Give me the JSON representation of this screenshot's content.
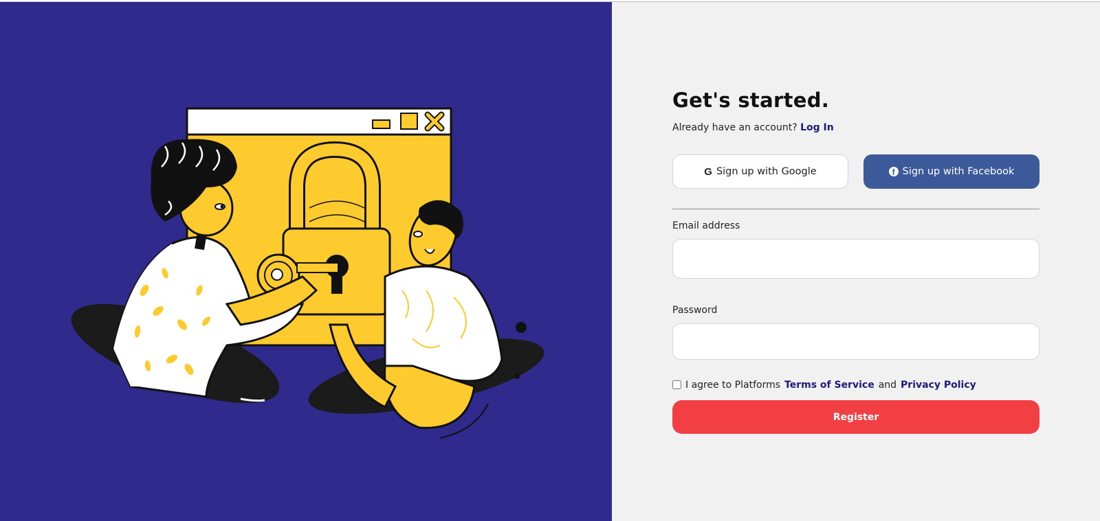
{
  "heading": "Get's started.",
  "login_prompt": {
    "text": "Already have an account?",
    "link_label": "Log In"
  },
  "social": {
    "google_label": "Sign up with Google",
    "facebook_label": "Sign up with Facebook"
  },
  "form": {
    "email_label": "Email address",
    "email_value": "",
    "password_label": "Password",
    "password_value": "",
    "agree_prefix": "I agree to Platforms",
    "terms_label": "Terms of Service",
    "agree_and": "and",
    "privacy_label": "Privacy Policy",
    "register_label": "Register"
  },
  "icons": {
    "google": "G",
    "facebook": "f"
  },
  "colors": {
    "left_bg": "#2f2a8c",
    "right_bg": "#f1f1f1",
    "accent_yellow": "#fecb2f",
    "facebook": "#3c5a99",
    "register": "#f23f44",
    "link": "#1f1a7a"
  }
}
